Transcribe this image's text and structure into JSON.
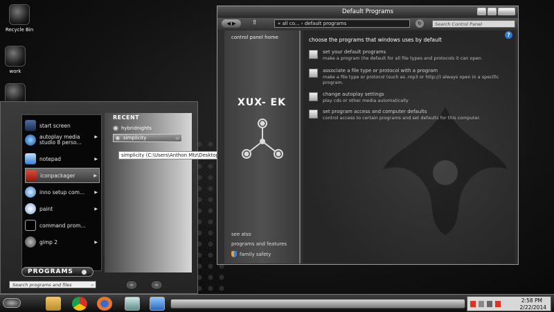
{
  "desktop": {
    "icons": [
      {
        "label": "Recycle Bin"
      },
      {
        "label": "work"
      },
      {
        "label": ""
      }
    ]
  },
  "start_menu": {
    "programs": [
      {
        "label": "start screen",
        "icon": "start-screen-icon",
        "arrow": false
      },
      {
        "label": "autoplay media studio 8 perso...",
        "icon": "autoplay-icon",
        "arrow": true
      },
      {
        "label": "notepad",
        "icon": "notepad-icon",
        "arrow": true
      },
      {
        "label": "iconpackager",
        "icon": "iconpackager-icon",
        "arrow": true
      },
      {
        "label": "inno setup com...",
        "icon": "inno-setup-icon",
        "arrow": true
      },
      {
        "label": "paint",
        "icon": "paint-icon",
        "arrow": true
      },
      {
        "label": "command prom...",
        "icon": "command-prompt-icon",
        "arrow": false
      },
      {
        "label": "gimp 2",
        "icon": "gimp-icon",
        "arrow": true
      }
    ],
    "recent_title": "RECENT",
    "recent": [
      "hybridnights",
      "simplicity"
    ],
    "tooltip": "simplicity (C:\\Users\\Anthon Mtz\\Desktop)",
    "programs_label": "PROGRAMS",
    "search_placeholder": "Search programs and files"
  },
  "control_panel": {
    "title": "Default Programs",
    "address": "« all co... › default programs",
    "search_placeholder": "Search Control Panel",
    "sidebar": {
      "home": "control panel home",
      "logo": "XUX- EK",
      "see_also": "see also",
      "links": [
        "programs and features",
        "family safety"
      ]
    },
    "heading": "choose the programs that windows uses by default",
    "tasks": [
      {
        "link": "set your default programs",
        "desc": "make a program the default for all file types and protocols it can open."
      },
      {
        "link": "associate a file type or protocol with a program",
        "desc": "make a file type or protocol (such as .mp3 or http://) always open in a specific program."
      },
      {
        "link": "change autoplay settings",
        "desc": "play cds or other media automatically"
      },
      {
        "link": "set program access and computer defaults",
        "desc": "control access to certain programs and set defaults for this computer."
      }
    ]
  },
  "taskbar": {
    "time": "2:58 PM",
    "date": "2/22/2014"
  },
  "colors": {
    "accent_blue": "#2b78d8",
    "chrome_red": "#d93025",
    "firefox_orange": "#e8762c"
  }
}
